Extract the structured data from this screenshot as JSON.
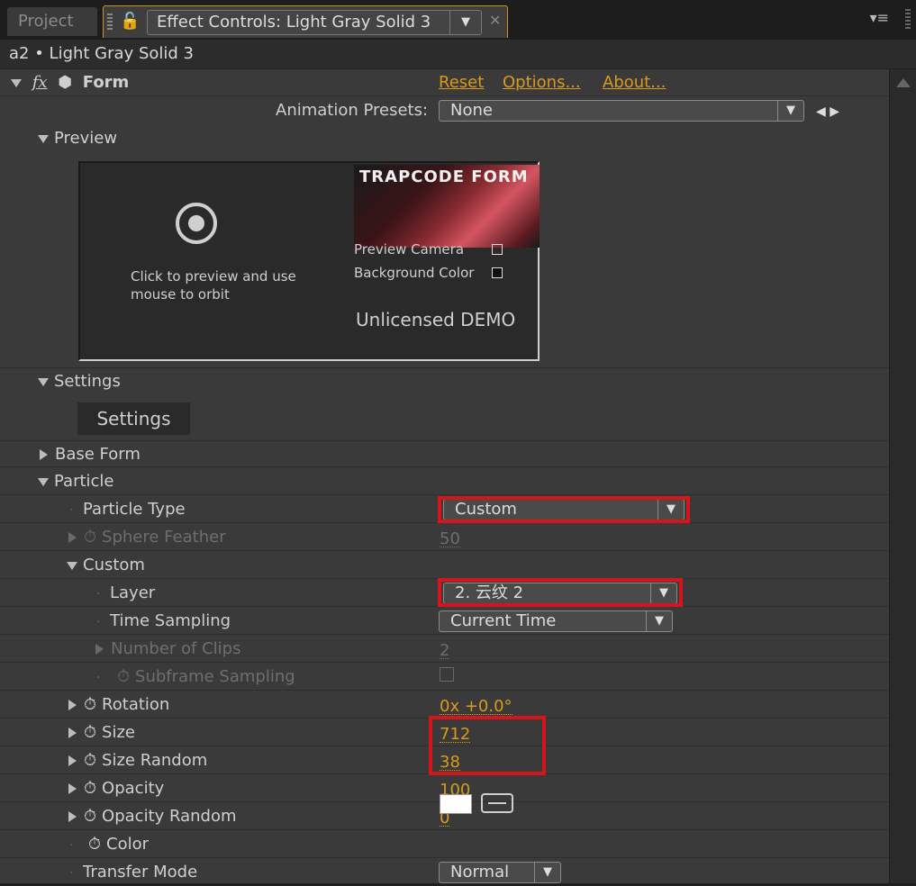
{
  "tabs": {
    "project": "Project",
    "effect_title": "Effect Controls: Light Gray Solid 3"
  },
  "layer_header": "a2 • Light Gray Solid 3",
  "effect": {
    "name": "Form",
    "reset": "Reset",
    "options": "Options...",
    "about": "About...",
    "animation_presets_label": "Animation Presets:",
    "animation_presets_value": "None"
  },
  "preview": {
    "section_label": "Preview",
    "hint": "Click to preview and use mouse to orbit",
    "logo_text": "TRAPCODE FORM",
    "preview_camera": "Preview Camera",
    "background_color": "Background Color",
    "demo": "Unlicensed DEMO"
  },
  "settings": {
    "section_label": "Settings",
    "button": "Settings"
  },
  "base_form": "Base Form",
  "particle": {
    "section_label": "Particle",
    "particle_type": {
      "label": "Particle Type",
      "value": "Custom"
    },
    "sphere_feather": {
      "label": "Sphere Feather",
      "value": "50"
    },
    "custom": {
      "label": "Custom",
      "layer": {
        "label": "Layer",
        "value": "2. 云纹 2"
      },
      "time_sampling": {
        "label": "Time Sampling",
        "value": "Current Time"
      },
      "number_of_clips": {
        "label": "Number of Clips",
        "value": "2"
      },
      "subframe_sampling": {
        "label": "Subframe Sampling"
      }
    },
    "rotation": {
      "label": "Rotation",
      "value": "0x +0.0°"
    },
    "size": {
      "label": "Size",
      "value": "712"
    },
    "size_random": {
      "label": "Size Random",
      "value": "38"
    },
    "opacity": {
      "label": "Opacity",
      "value": "100"
    },
    "opacity_random": {
      "label": "Opacity Random",
      "value": "0"
    },
    "color": {
      "label": "Color",
      "swatch": "#ffffff"
    },
    "transfer_mode": {
      "label": "Transfer Mode",
      "value": "Normal"
    }
  },
  "colors": {
    "accent": "#d99a1e",
    "highlight": "#d4151b"
  }
}
